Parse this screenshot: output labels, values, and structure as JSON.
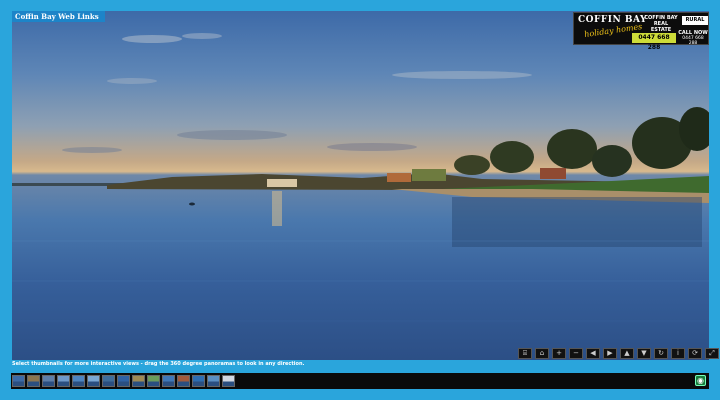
{
  "header": {
    "title": "Coffin Bay Web Links"
  },
  "ad": {
    "brand_line1": "COFFIN BAY",
    "brand_line2": "holiday homes",
    "real_estate": "COFFIN BAY REAL ESTATE",
    "partner": "RURAL",
    "phone": "0447 668 288",
    "call_label": "CALL NOW",
    "call_detail": "0447 668 288"
  },
  "footer": {
    "caption": "Select thumbnails for more interactive views - drag the 360 degree panoramas to look in any direction."
  },
  "controls": [
    {
      "name": "map-icon",
      "glyph": "⌸"
    },
    {
      "name": "home-icon",
      "glyph": "⌂"
    },
    {
      "name": "zoom-in-icon",
      "glyph": "+"
    },
    {
      "name": "zoom-out-icon",
      "glyph": "−"
    },
    {
      "name": "pan-left-icon",
      "glyph": "◀"
    },
    {
      "name": "pan-right-icon",
      "glyph": "▶"
    },
    {
      "name": "pan-up-icon",
      "glyph": "▲"
    },
    {
      "name": "pan-down-icon",
      "glyph": "▼"
    },
    {
      "name": "auto-rotate-icon",
      "glyph": "↻"
    },
    {
      "name": "info-icon",
      "glyph": "i"
    },
    {
      "name": "refresh-icon",
      "glyph": "⟳"
    },
    {
      "name": "fullscreen-icon",
      "glyph": "⤢"
    }
  ],
  "thumbnails": [
    {
      "color": "#3c6aa6"
    },
    {
      "color": "#8a7550"
    },
    {
      "color": "#5d7ea8"
    },
    {
      "color": "#6f99c9"
    },
    {
      "color": "#4d84c0"
    },
    {
      "color": "#7aa7d3"
    },
    {
      "color": "#3e6c9a"
    },
    {
      "color": "#2f62a4"
    },
    {
      "color": "#9d8a56"
    },
    {
      "color": "#6a9b5b"
    },
    {
      "color": "#3f78b8"
    },
    {
      "color": "#a05a3c"
    },
    {
      "color": "#2d6db1"
    },
    {
      "color": "#5b8fc2"
    },
    {
      "color": "#d1d8e2"
    }
  ]
}
